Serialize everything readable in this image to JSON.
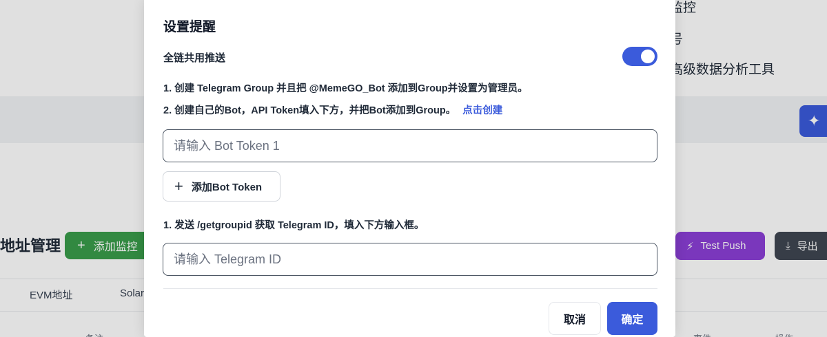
{
  "background": {
    "right_menu": [
      "监控",
      "号",
      "高级数据分析工具"
    ],
    "page_title": "地址管理",
    "add_monitor_label": "添加监控",
    "test_push_label": "Test Push",
    "export_label": "导出",
    "tabs": [
      "EVM地址",
      "Solar"
    ],
    "table_headers": [
      "备注",
      "事件",
      "操作"
    ]
  },
  "modal": {
    "title": "设置提醒",
    "share_label": "全链共用推送",
    "share_enabled": true,
    "step1": "1. 创建 Telegram Group 并且把 @MemeGO_Bot 添加到Group并设置为管理员。",
    "step2": "2. 创建自己的Bot，API Token填入下方，并把Bot添加到Group。",
    "step2_link": "点击创建",
    "token_placeholder": "请输入 Bot Token 1",
    "token_value": "",
    "add_token_label": "添加Bot Token",
    "step3": "1. 发送 /getgroupid 获取 Telegram ID，填入下方输入框。",
    "telegram_placeholder": "请输入 Telegram ID",
    "telegram_value": "",
    "cancel_label": "取消",
    "confirm_label": "确定"
  },
  "colors": {
    "primary": "#3b5bdb",
    "success": "#3a9d4b",
    "purple": "#8b3fd6",
    "dark": "#3f4651"
  },
  "icons": [
    "sparkle-icon",
    "plus-icon",
    "lightning-icon",
    "export-icon"
  ]
}
